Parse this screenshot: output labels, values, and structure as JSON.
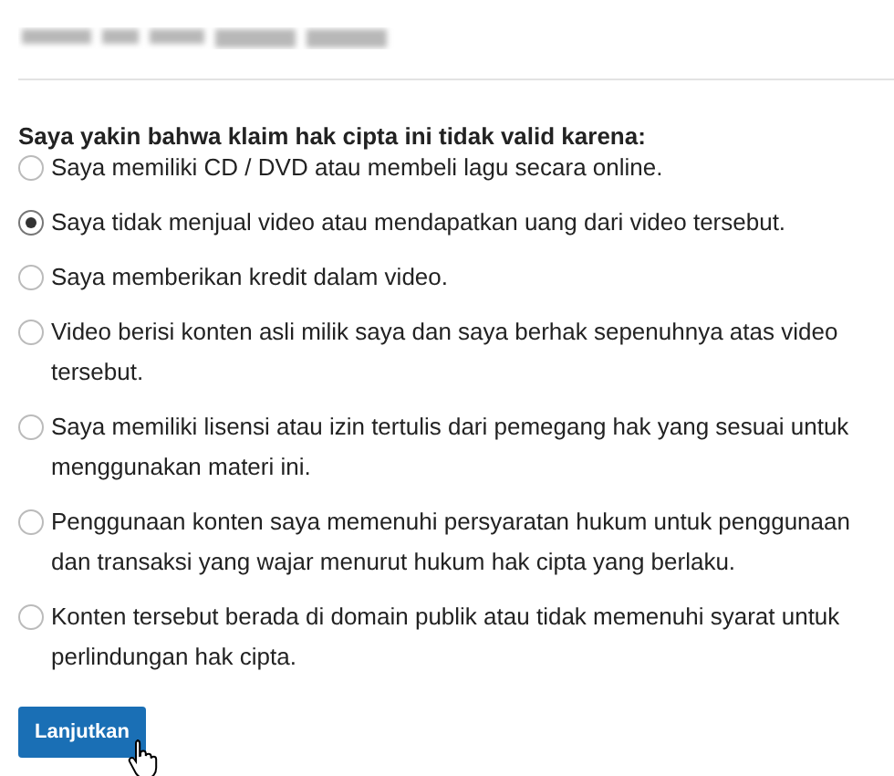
{
  "question": "Saya yakin bahwa klaim hak cipta ini tidak valid karena:",
  "options": [
    {
      "label": "Saya memiliki CD / DVD atau membeli lagu secara online.",
      "selected": false
    },
    {
      "label": "Saya tidak menjual video atau mendapatkan uang dari video tersebut.",
      "selected": true
    },
    {
      "label": "Saya memberikan kredit dalam video.",
      "selected": false
    },
    {
      "label": "Video berisi konten asli milik saya dan saya berhak sepenuhnya atas video tersebut.",
      "selected": false
    },
    {
      "label": "Saya memiliki lisensi atau izin tertulis dari pemegang hak yang sesuai untuk menggunakan materi ini.",
      "selected": false
    },
    {
      "label": "Penggunaan konten saya memenuhi persyaratan hukum untuk penggunaan dan transaksi yang wajar menurut hukum hak cipta yang berlaku.",
      "selected": false
    },
    {
      "label": "Konten tersebut berada di domain publik atau tidak memenuhi syarat untuk perlindungan hak cipta.",
      "selected": false
    }
  ],
  "button": "Lanjutkan"
}
